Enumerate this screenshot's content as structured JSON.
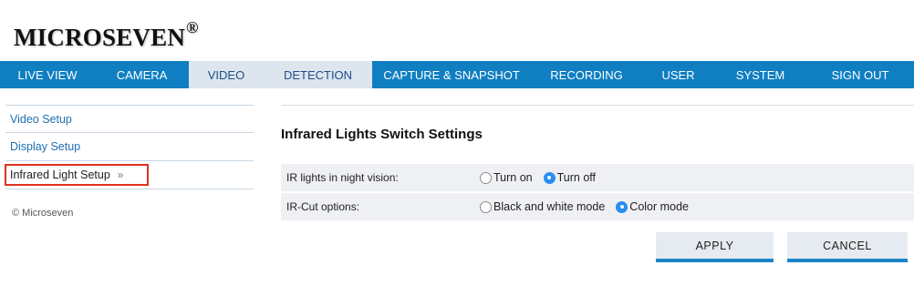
{
  "brand": {
    "name": "MICROSEVEN",
    "mark": "®"
  },
  "nav": {
    "items": [
      {
        "label": "LIVE VIEW"
      },
      {
        "label": "CAMERA"
      },
      {
        "label": "VIDEO",
        "active": true
      },
      {
        "label": "DETECTION",
        "active": true
      },
      {
        "label": "CAPTURE & SNAPSHOT"
      },
      {
        "label": "RECORDING"
      },
      {
        "label": "USER"
      },
      {
        "label": "SYSTEM"
      },
      {
        "label": "SIGN OUT"
      }
    ]
  },
  "sidebar": {
    "items": [
      {
        "label": "Video Setup"
      },
      {
        "label": "Display Setup"
      },
      {
        "label": "Infrared Light Setup",
        "suffix": "»",
        "selected": true
      }
    ],
    "copyright": "© Microseven"
  },
  "settings": {
    "title": "Infrared Lights Switch Settings",
    "rows": [
      {
        "label": "IR lights in night vision:",
        "options": [
          {
            "label": "Turn on",
            "checked": false
          },
          {
            "label": "Turn off",
            "checked": true
          }
        ]
      },
      {
        "label": "IR-Cut options:",
        "options": [
          {
            "label": "Black and white mode",
            "checked": false
          },
          {
            "label": "Color mode",
            "checked": true
          }
        ]
      }
    ]
  },
  "buttons": {
    "apply": "APPLY",
    "cancel": "CANCEL"
  },
  "colors": {
    "nav_bg": "#0f7fc2",
    "nav_active_bg": "#dde5ef",
    "highlight_border": "#e0321d",
    "radio_checked": "#2a8ef0"
  }
}
